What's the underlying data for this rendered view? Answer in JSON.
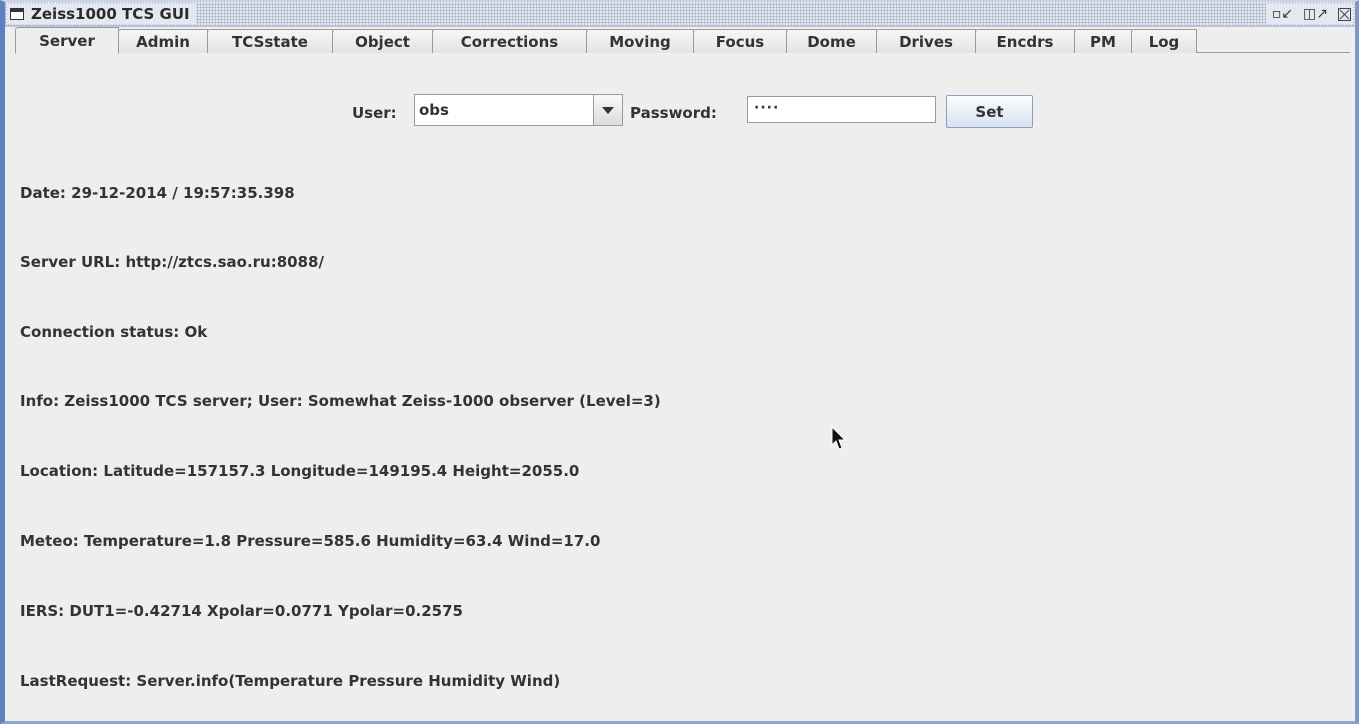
{
  "window": {
    "title": "Zeiss1000 TCS GUI"
  },
  "tabs": [
    {
      "label": "Server",
      "active": true
    },
    {
      "label": "Admin"
    },
    {
      "label": "TCSstate"
    },
    {
      "label": "Object"
    },
    {
      "label": "Corrections"
    },
    {
      "label": "Moving"
    },
    {
      "label": "Focus"
    },
    {
      "label": "Dome"
    },
    {
      "label": "Drives"
    },
    {
      "label": "Encdrs"
    },
    {
      "label": "PM"
    },
    {
      "label": "Log"
    }
  ],
  "login": {
    "user_label": "User:",
    "user_value": "obs",
    "password_label": "Password:",
    "password_value": "····",
    "set_label": "Set"
  },
  "info": {
    "date": "Date: 29-12-2014 / 19:57:35.398",
    "server_url": "Server URL: http://ztcs.sao.ru:8088/",
    "connection_status": "Connection status: Ok",
    "info": "Info: Zeiss1000 TCS server; User: Somewhat Zeiss-1000 observer (Level=3)",
    "location": "Location: Latitude=157157.3 Longitude=149195.4 Height=2055.0",
    "meteo": "Meteo: Temperature=1.8 Pressure=585.6 Humidity=63.4 Wind=17.0",
    "iers": "IERS: DUT1=-0.42714 Xpolar=0.0771 Ypolar=0.2575",
    "last_request": "LastRequest: Server.info(Temperature Pressure Humidity Wind)"
  },
  "icons": {
    "window": "window-icon",
    "minimize": "minimize-icon",
    "maximize": "maximize-icon",
    "close": "close-icon",
    "dropdown": "chevron-down-icon",
    "cursor": "mouse-pointer-icon"
  },
  "colors": {
    "window_border": "#5f7fbf",
    "button_bg": "#d8e2f0",
    "panel_bg": "#eeeeee"
  }
}
